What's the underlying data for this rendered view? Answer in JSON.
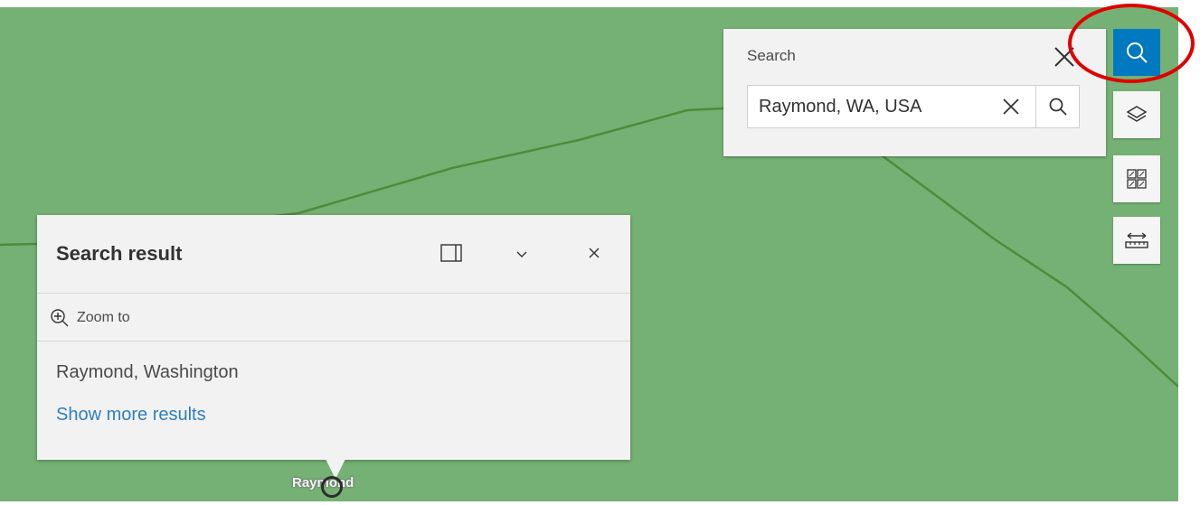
{
  "map": {
    "background": "#75b174",
    "road_color": "#4f8b3c",
    "place_label": "Raymond"
  },
  "search": {
    "title": "Search",
    "query": "Raymond, WA, USA",
    "close_icon": "close-icon",
    "clear_icon": "clear-icon",
    "submit_icon": "search-icon"
  },
  "toolbar": {
    "items": [
      {
        "name": "search",
        "icon": "search-icon",
        "active": true
      },
      {
        "name": "layers",
        "icon": "layers-icon"
      },
      {
        "name": "basemap",
        "icon": "basemap-gallery-icon"
      },
      {
        "name": "measure",
        "icon": "measure-icon"
      }
    ],
    "active_color": "#0079c1",
    "highlight_color": "#e00000"
  },
  "popup": {
    "title": "Search result",
    "zoom_label": "Zoom to",
    "result_name": "Raymond, Washington",
    "more_results": "Show more results"
  }
}
